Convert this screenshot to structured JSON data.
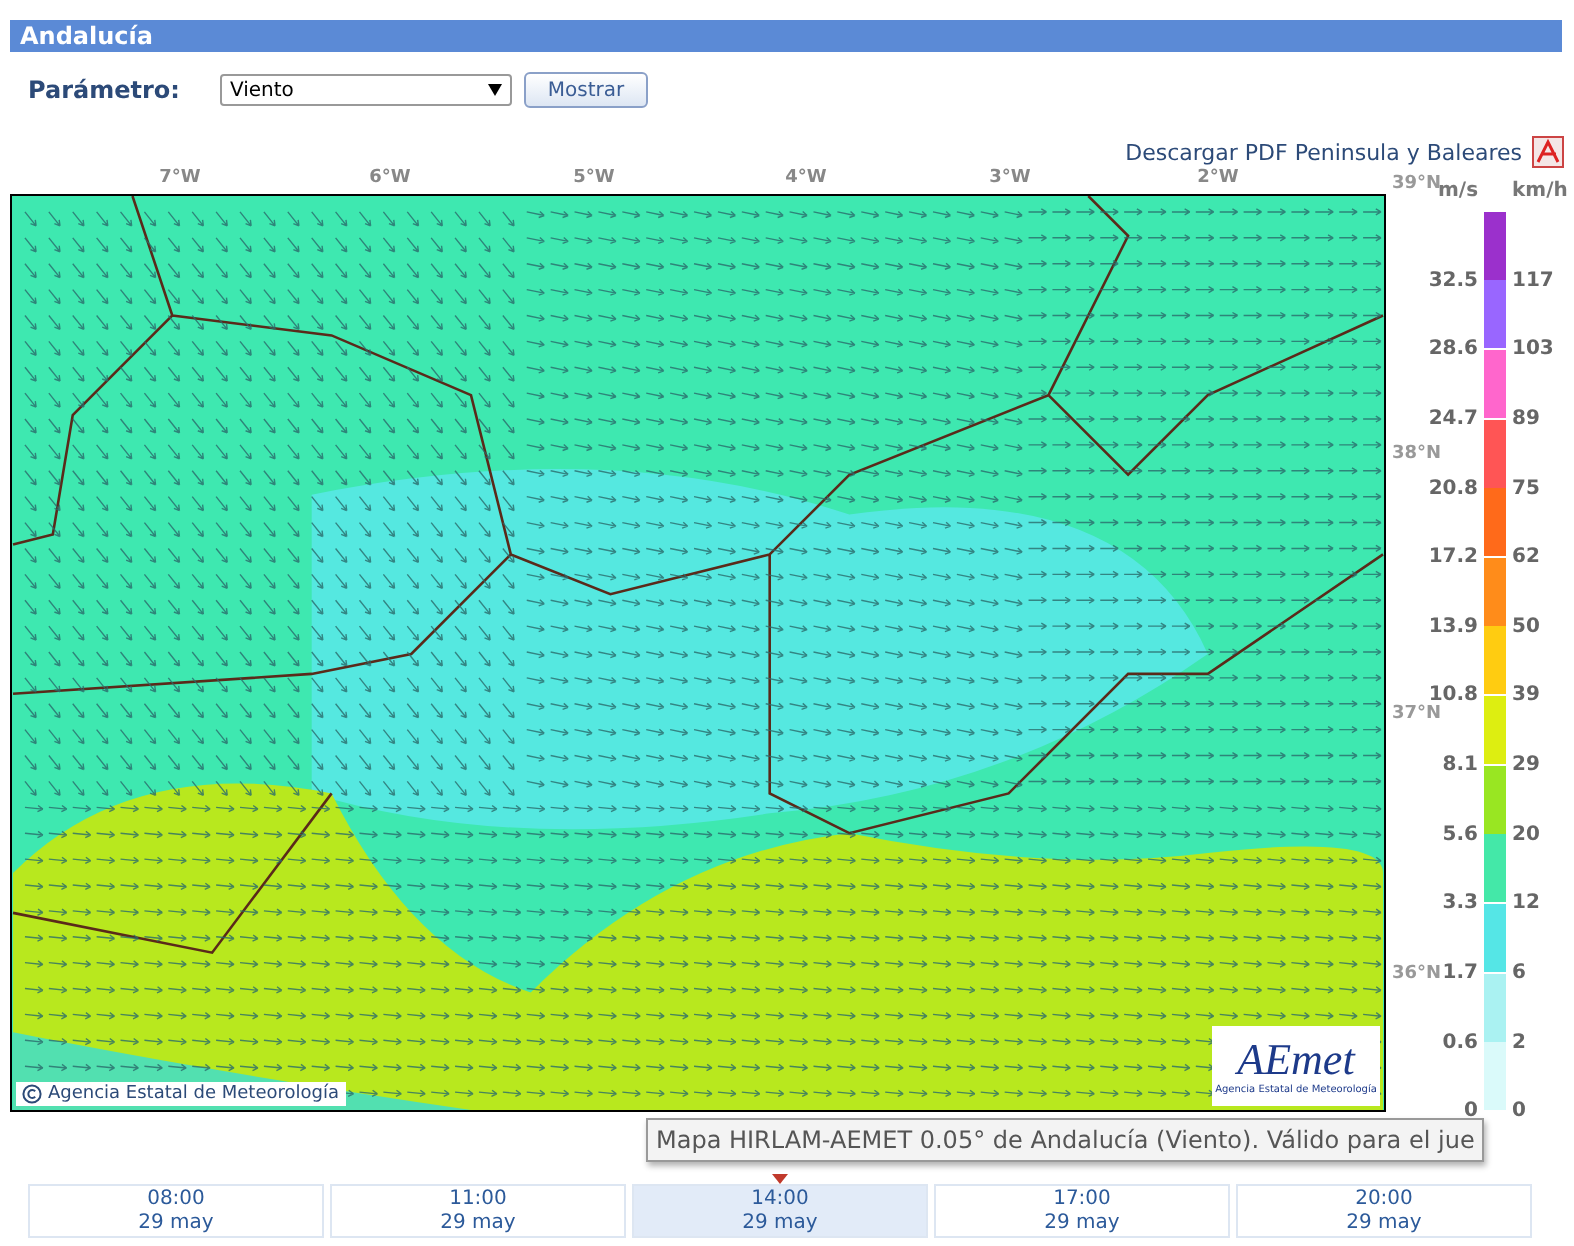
{
  "header": {
    "title": "Andalucía"
  },
  "form": {
    "label": "Parámetro:",
    "select_value": "Viento",
    "button": "Mostrar"
  },
  "download": {
    "label": "Descargar PDF Peninsula y Baleares"
  },
  "map": {
    "lon_labels": [
      "7°W",
      "6°W",
      "5°W",
      "4°W",
      "3°W",
      "2°W"
    ],
    "lat_labels": [
      "39°N",
      "38°N",
      "37°N",
      "36°N"
    ],
    "copyright": "Agencia Estatal de Meteorología",
    "logo": {
      "name": "AEmet",
      "subtitle": "Agencia Estatal de Meteorología"
    }
  },
  "legend": {
    "unit_ms": "m/s",
    "unit_kmh": "km/h",
    "items": [
      {
        "ms": "32.5",
        "kmh": "117",
        "color": "#9b30cc"
      },
      {
        "ms": "28.6",
        "kmh": "103",
        "color": "#9966ff"
      },
      {
        "ms": "24.7",
        "kmh": "89",
        "color": "#ff66cc"
      },
      {
        "ms": "20.8",
        "kmh": "75",
        "color": "#ff5555"
      },
      {
        "ms": "17.2",
        "kmh": "62",
        "color": "#ff6a1a"
      },
      {
        "ms": "13.9",
        "kmh": "50",
        "color": "#ff8c1a"
      },
      {
        "ms": "10.8",
        "kmh": "39",
        "color": "#ffcc11"
      },
      {
        "ms": "8.1",
        "kmh": "29",
        "color": "#ddee11"
      },
      {
        "ms": "5.6",
        "kmh": "20",
        "color": "#99e622"
      },
      {
        "ms": "3.3",
        "kmh": "12",
        "color": "#44e8a8"
      },
      {
        "ms": "1.7",
        "kmh": "6",
        "color": "#55e6e6"
      },
      {
        "ms": "0.6",
        "kmh": "2",
        "color": "#aaf2f2"
      },
      {
        "ms": "0",
        "kmh": "0",
        "color": "#dafafa"
      }
    ]
  },
  "tooltip": "Mapa HIRLAM-AEMET 0.05° de Andalucía (Viento). Válido para el jue",
  "times": [
    {
      "time": "08:00",
      "date": "29 may",
      "selected": false
    },
    {
      "time": "11:00",
      "date": "29 may",
      "selected": false
    },
    {
      "time": "14:00",
      "date": "29 may",
      "selected": true
    },
    {
      "time": "17:00",
      "date": "29 may",
      "selected": false
    },
    {
      "time": "20:00",
      "date": "29 may",
      "selected": false
    }
  ]
}
